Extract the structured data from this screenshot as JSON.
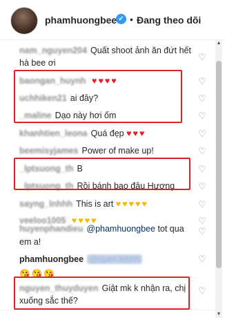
{
  "header": {
    "username": "phamhuongbee",
    "verified_mark": "✓",
    "separator": "•",
    "follow_status": "Đang theo dõi"
  },
  "comments": [
    {
      "user": "nam_nguyen204",
      "text": "Quất shoot ảnh ăn đứt hết hà bee ơi",
      "hearts": [],
      "heart_color": ""
    },
    {
      "user": "baongan_huynh",
      "text": "",
      "hearts": [
        "♥",
        "♥",
        "♥",
        "♥"
      ],
      "heart_color": "red"
    },
    {
      "user": "uchhiken21",
      "text": "ai đây?",
      "hearts": [],
      "heart_color": ""
    },
    {
      "user": "_maline",
      "text": "Dạo này hơi ốm",
      "hearts": [],
      "heart_color": ""
    },
    {
      "user": "khanhtien_leona",
      "text": "Quá đẹp",
      "hearts": [
        "♥",
        "♥",
        "♥"
      ],
      "heart_color": "red"
    },
    {
      "user": "beemisyjames",
      "text": "Power of make up!",
      "hearts": [],
      "heart_color": ""
    },
    {
      "user": "_lptsuong_th",
      "text": "B",
      "hearts": [],
      "heart_color": ""
    },
    {
      "user": "_lptsuong_th",
      "text": "Rồi bánh bao đâu Hương",
      "hearts": [],
      "heart_color": ""
    },
    {
      "user": "sayng_lnhhh",
      "text": "This is art",
      "hearts": [
        "♥",
        "♥",
        "♥",
        "♥",
        "♥"
      ],
      "heart_color": "yellow"
    },
    {
      "user": "veeloo1005",
      "text": "",
      "hearts": [
        "♥",
        "♥",
        "♥",
        "♥"
      ],
      "heart_color": "yellow"
    },
    {
      "user": "huyenphandieu",
      "text": "tot qua em a!",
      "mention": "@phamhuongbee",
      "hearts": [],
      "heart_color": ""
    },
    {
      "user": "phamhuongbee",
      "text": "",
      "mention": "@uyen.lnhhh",
      "hearts": [
        "😘",
        "😘",
        "😘"
      ],
      "heart_color": "emoji"
    },
    {
      "user": "nguyen_thuyduyen",
      "text": "Giật mk k nhận ra, chị xuống sắc thế?",
      "hearts": [],
      "heart_color": ""
    }
  ],
  "icons": {
    "like": "♡",
    "scroll_up": "▲",
    "scroll_down": "▼"
  },
  "colors": {
    "highlight_box": "#e02020",
    "red_heart": "#ed1c24",
    "yellow_heart": "#f5b800",
    "verified": "#3897f0"
  }
}
